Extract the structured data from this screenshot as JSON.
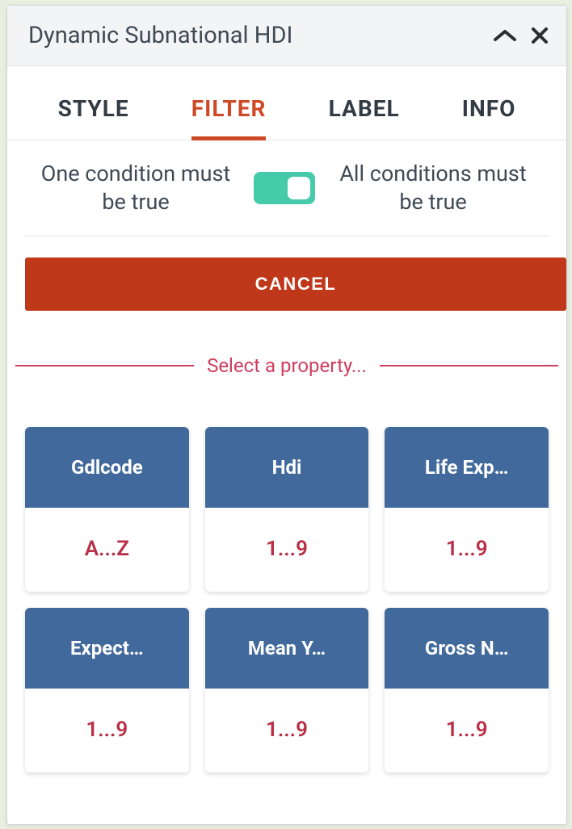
{
  "header": {
    "title": "Dynamic Subnational HDI"
  },
  "tabs": {
    "style": "STYLE",
    "filter": "FILTER",
    "label": "LABEL",
    "info": "INFO"
  },
  "conditions": {
    "left": "One condition must be true",
    "right": "All conditions must be true"
  },
  "buttons": {
    "cancel": "CANCEL"
  },
  "divider": {
    "label": "Select a property..."
  },
  "properties": [
    {
      "name": "Gdlcode",
      "range": "A...Z"
    },
    {
      "name": "Hdi",
      "range": "1...9"
    },
    {
      "name": "Life Exp…",
      "range": "1...9"
    },
    {
      "name": "Expect…",
      "range": "1...9"
    },
    {
      "name": "Mean Y…",
      "range": "1...9"
    },
    {
      "name": "Gross N…",
      "range": "1...9"
    }
  ]
}
